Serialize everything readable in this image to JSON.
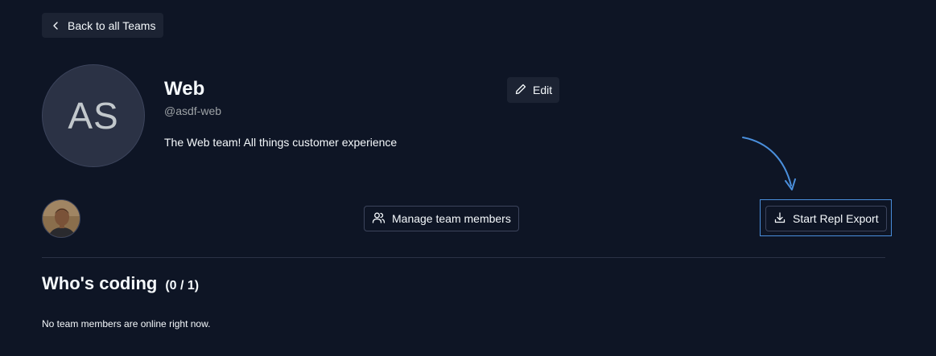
{
  "nav": {
    "back_label": "Back to all Teams"
  },
  "team": {
    "initials": "AS",
    "name": "Web",
    "handle": "@asdf-web",
    "description": "The Web team! All things customer experience",
    "edit_label": "Edit"
  },
  "members": {
    "manage_label": "Manage team members"
  },
  "export": {
    "label": "Start Repl Export"
  },
  "coding": {
    "title": "Who's coding",
    "count": "(0 / 1)",
    "empty_message": "No team members are online right now."
  },
  "colors": {
    "background": "#0e1525",
    "surface": "#1c2333",
    "border": "#3c445c",
    "accent": "#4a8fdc"
  }
}
